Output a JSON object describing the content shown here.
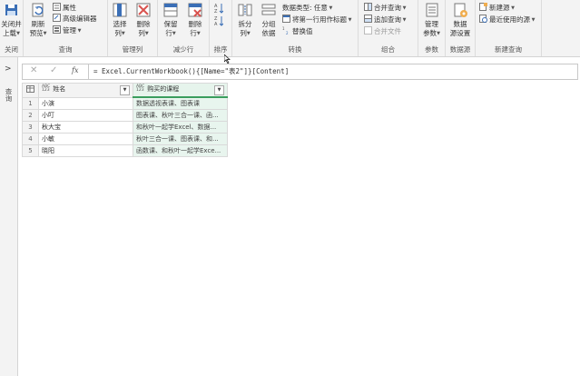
{
  "ribbon": {
    "groups": {
      "close": "关闭",
      "query": "查询",
      "manage_cols": "管理列",
      "reduce_rows": "减少行",
      "sort": "排序",
      "transform": "转换",
      "combine": "组合",
      "params": "参数",
      "datasource": "数据源",
      "new_query": "新建查询"
    },
    "btn_close_line1": "关闭并",
    "btn_close_line2": "上载",
    "btn_refresh_line1": "刷新",
    "btn_refresh_line2": "预览",
    "btn_properties": "属性",
    "btn_advanced_editor": "高级编辑器",
    "btn_manage": "管理",
    "btn_choose_cols_line1": "选择",
    "btn_choose_cols_line2": "列",
    "btn_remove_cols_line1": "删除",
    "btn_remove_cols_line2": "列",
    "btn_keep_rows_line1": "保留",
    "btn_keep_rows_line2": "行",
    "btn_remove_rows_line1": "删除",
    "btn_remove_rows_line2": "行",
    "btn_split_line1": "拆分",
    "btn_split_line2": "列",
    "btn_group_line1": "分组",
    "btn_group_line2": "依据",
    "btn_datatype": "数据类型: 任意",
    "btn_first_row_header": "将第一行用作标题",
    "btn_replace": "替换值",
    "btn_merge_queries": "合并查询",
    "btn_append_queries": "追加查询",
    "btn_combine_files": "合并文件",
    "btn_manage_params_line1": "管理",
    "btn_manage_params_line2": "参数",
    "btn_datasource_line1": "数据",
    "btn_datasource_line2": "源设置",
    "btn_new_source": "新建源",
    "btn_recent_sources": "最近使用的源"
  },
  "side_panel": {
    "toggle": ">",
    "label": "查询"
  },
  "formula_bar": {
    "cancel": "✕",
    "confirm": "✓",
    "fx": "fx",
    "formula": "= Excel.CurrentWorkbook(){[Name=\"表2\"]}[Content]"
  },
  "grid": {
    "type_tag_top": "ABC",
    "type_tag_bottom": "123",
    "columns": [
      "姓名",
      "购买的课程"
    ],
    "rows": [
      [
        "小演",
        "数据透视表课、图表课"
      ],
      [
        "小叮",
        "图表课、秋叶三合一课、函..."
      ],
      [
        "秋大宝",
        "和秋叶一起学Excel、数据..."
      ],
      [
        "小敏",
        "秋叶三合一课、图表课、和..."
      ],
      [
        "晓阳",
        "函数课、和秋叶一起学Exce..."
      ]
    ]
  },
  "colors": {
    "accent_green": "#3a9d5d",
    "ribbon_bg": "#f3f3f3",
    "selected_col": "#e8f5ee"
  }
}
